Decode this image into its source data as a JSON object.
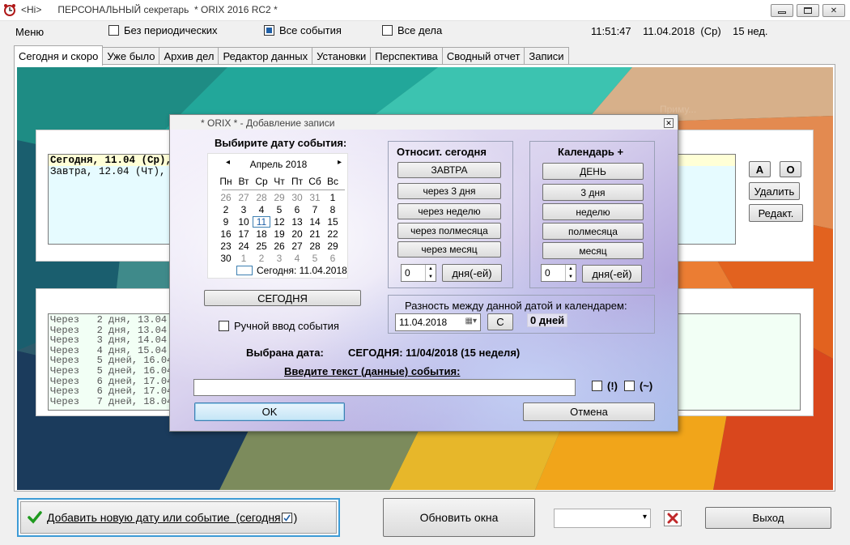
{
  "window": {
    "title": "<Hi>      ПЕРСОНАЛЬНЫЙ секретарь  * ORIX 2016 RC2 *",
    "min_label": "▭",
    "max_label": "▢",
    "close_label": "✕"
  },
  "menu": {
    "label": "Меню",
    "no_periodic": "Без периодических",
    "all_events": "Все события",
    "all_tasks": "Все дела",
    "clock": "11:51:47    11.04.2018  (Ср)    15 нед."
  },
  "tabs": [
    "Сегодня и скоро",
    "Уже было",
    "Архив дел",
    "Редактор данных",
    "Установки",
    "Перспектива",
    "Сводный отчет",
    "Записи"
  ],
  "main": {
    "today_line": "Сегодня, 11.04 (Ср), {",
    "tomorrow_line": "Завтра, 12.04 (Чт), будет",
    "btn_a": "А",
    "btn_o": "О",
    "btn_delete": "Удалить",
    "btn_edit": "Редакт.",
    "upcoming": [
      "Через   2 дня, 13.04 (Пт)",
      "Через   2 дня, 13.04 (Пт)",
      "Через   3 дня, 14.04 (Сб)",
      "Через   4 дня, 15.04 (Вс)",
      "Через   5 дней, 16.04 (Пн",
      "Через   5 дней, 16.04 (Пн",
      "Через   6 дней, 17.04 (Вт",
      "Через   6 дней, 17.04 (Вт",
      "Через   7 дней, 18.04 (Ср)"
    ],
    "faded_watermark": "Приму..."
  },
  "dialog": {
    "title": "* ORIX * - Добавление записи",
    "close_label": "✕",
    "choose_date": "Выбирите дату события:",
    "calendar": {
      "month": "Апрель 2018",
      "prev": "◂",
      "next": "▸",
      "weekdays": [
        "Пн",
        "Вт",
        "Ср",
        "Чт",
        "Пт",
        "Сб",
        "Вс"
      ],
      "rows": [
        [
          "26",
          "27",
          "28",
          "29",
          "30",
          "31",
          "1"
        ],
        [
          "2",
          "3",
          "4",
          "5",
          "6",
          "7",
          "8"
        ],
        [
          "9",
          "10",
          "11",
          "12",
          "13",
          "14",
          "15"
        ],
        [
          "16",
          "17",
          "18",
          "19",
          "20",
          "21",
          "22"
        ],
        [
          "23",
          "24",
          "25",
          "26",
          "27",
          "28",
          "29"
        ],
        [
          "30",
          "1",
          "2",
          "3",
          "4",
          "5",
          "6"
        ]
      ],
      "today_label": "Сегодня: 11.04.2018"
    },
    "today_button": "СЕГОДНЯ",
    "manual_entry": "Ручной ввод события",
    "relative": {
      "title": "Относит. сегодня",
      "buttons": [
        "ЗАВТРА",
        "через 3 дня",
        "через неделю",
        "через полмесяца",
        "через месяц"
      ],
      "spin_value": "0",
      "days_button": "дня(-ей)"
    },
    "calendar_plus": {
      "title": "Календарь +",
      "buttons": [
        "ДЕНЬ",
        "3 дня",
        "неделю",
        "полмесяца",
        "месяц"
      ],
      "spin_value": "0",
      "days_button": "дня(-ей)"
    },
    "difference": {
      "label": "Разность между данной датой и календарем:",
      "date_value": "11.04.2018",
      "c_button": "С",
      "result": "0 дней"
    },
    "selected_label": "Выбрана дата:",
    "selected_value": "СЕГОДНЯ: 11/04/2018 (15 неделя)",
    "enter_text_label": "Введите текст (данные) события:",
    "text_value": "",
    "flag_excl": "(!)",
    "flag_tilde": "(~)",
    "ok": "OK",
    "cancel": "Отмена"
  },
  "bottom": {
    "add_button": "Добавить новую дату или событие  (сегодня",
    "refresh_button": "Обновить окна",
    "combo_value": "",
    "exit_button": "Выход"
  },
  "colors": {
    "selected_day_border": "#3c7fb1",
    "check_green": "#1f9a1f",
    "delete_red": "#c0282a"
  }
}
